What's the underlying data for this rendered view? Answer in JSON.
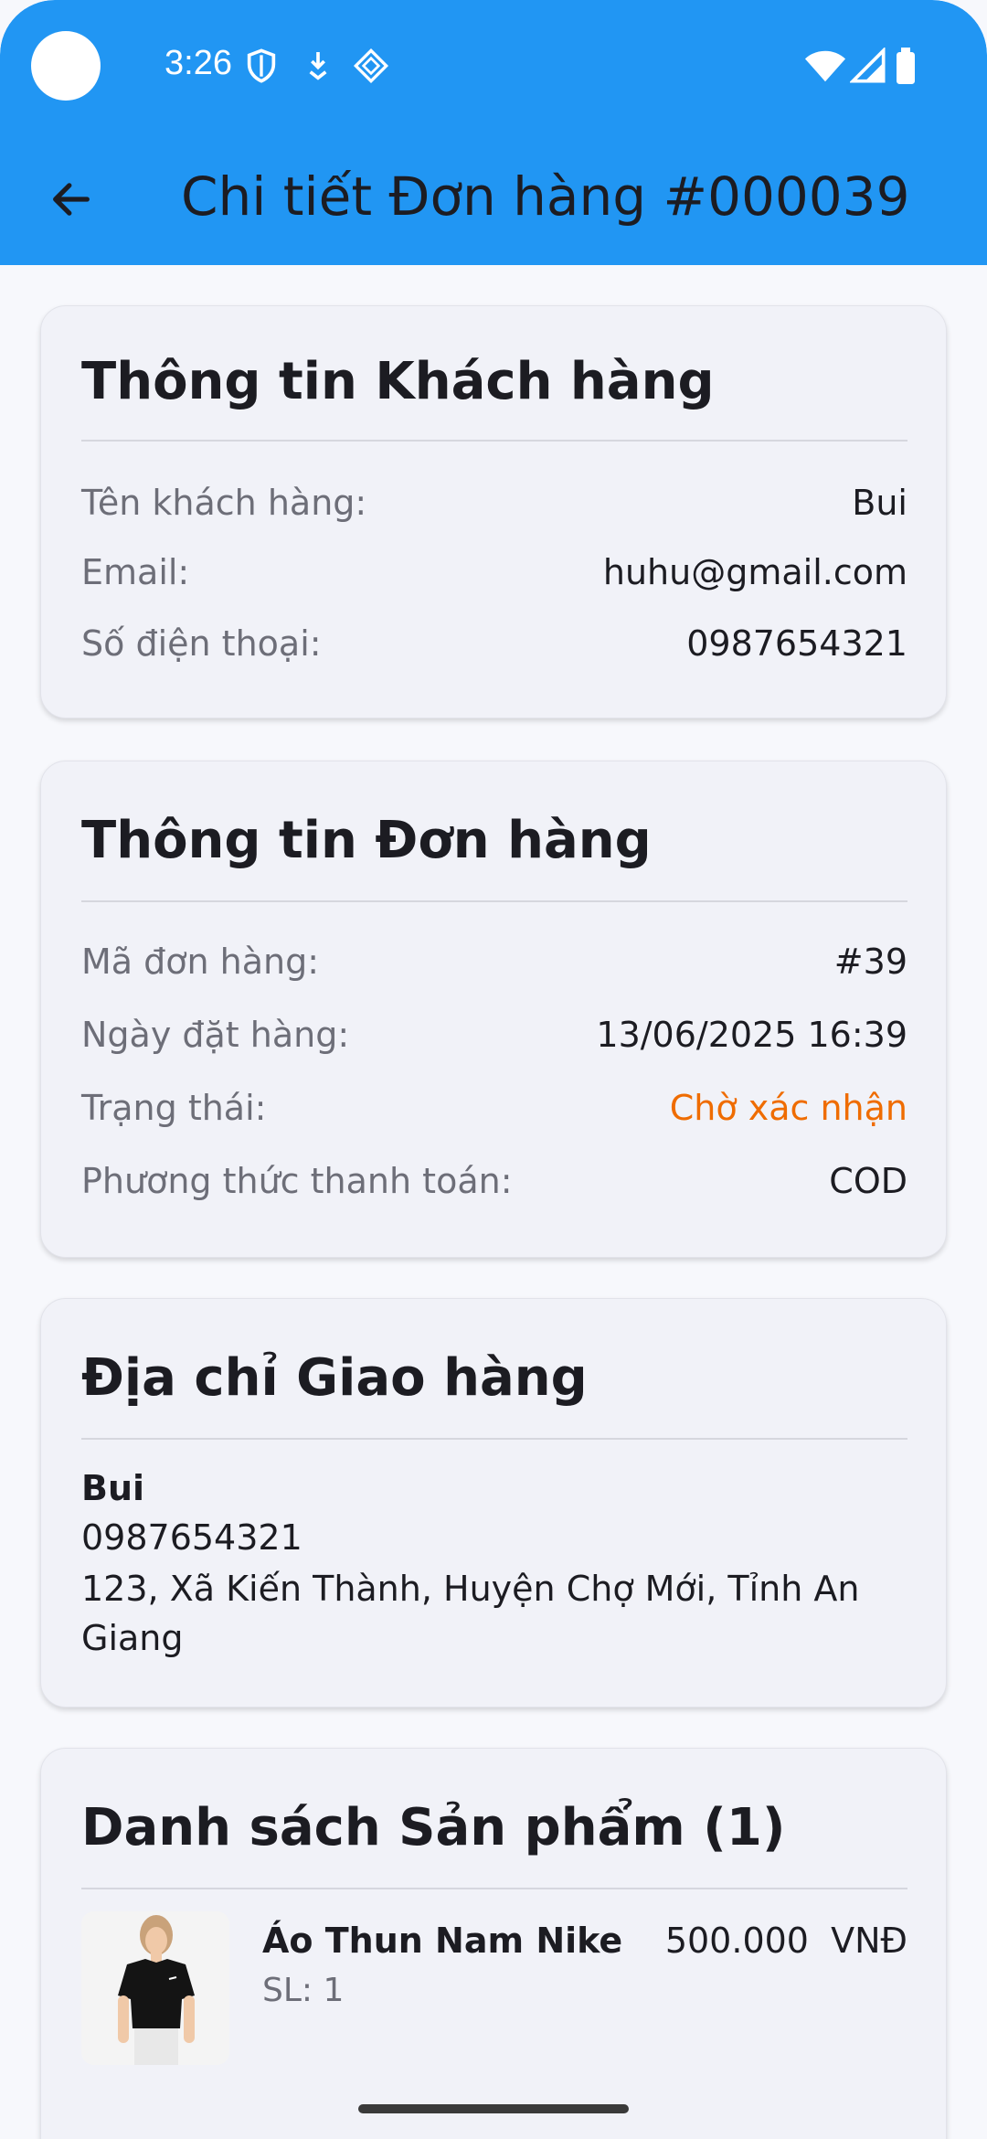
{
  "status_bar": {
    "time": "3:26",
    "icons": [
      "shield-icon",
      "download-icon",
      "diamond-icon",
      "wifi-icon",
      "signal-icon",
      "battery-icon"
    ]
  },
  "app_bar": {
    "title": "Chi tiết Đơn hàng #000039",
    "back_icon": "arrow-back-icon",
    "color": "#2196f3"
  },
  "customer": {
    "title": "Thông tin Khách hàng",
    "rows": [
      {
        "label": "Tên khách hàng:",
        "value": "Bui"
      },
      {
        "label": "Email:",
        "value": "huhu@gmail.com"
      },
      {
        "label": "Số điện thoại:",
        "value": "0987654321"
      }
    ]
  },
  "order": {
    "title": "Thông tin Đơn hàng",
    "rows": [
      {
        "label": "Mã đơn hàng:",
        "value": "#39"
      },
      {
        "label": "Ngày đặt hàng:",
        "value": "13/06/2025 16:39"
      },
      {
        "label": "Trạng thái:",
        "value": "Chờ xác nhận"
      },
      {
        "label": "Phương thức thanh toán:",
        "value": "COD"
      }
    ],
    "status_color": "#ef6c00"
  },
  "address": {
    "title": "Địa chỉ Giao hàng",
    "name": "Bui",
    "phone": "0987654321",
    "line": "123, Xã Kiến Thành, Huyện Chợ Mới, Tỉnh An Giang"
  },
  "products": {
    "title": "Danh sách Sản phẩm (1)",
    "items": [
      {
        "name": "Áo Thun Nam Nike",
        "qty": "SL: 1",
        "price": "500.000  VNĐ"
      }
    ]
  }
}
